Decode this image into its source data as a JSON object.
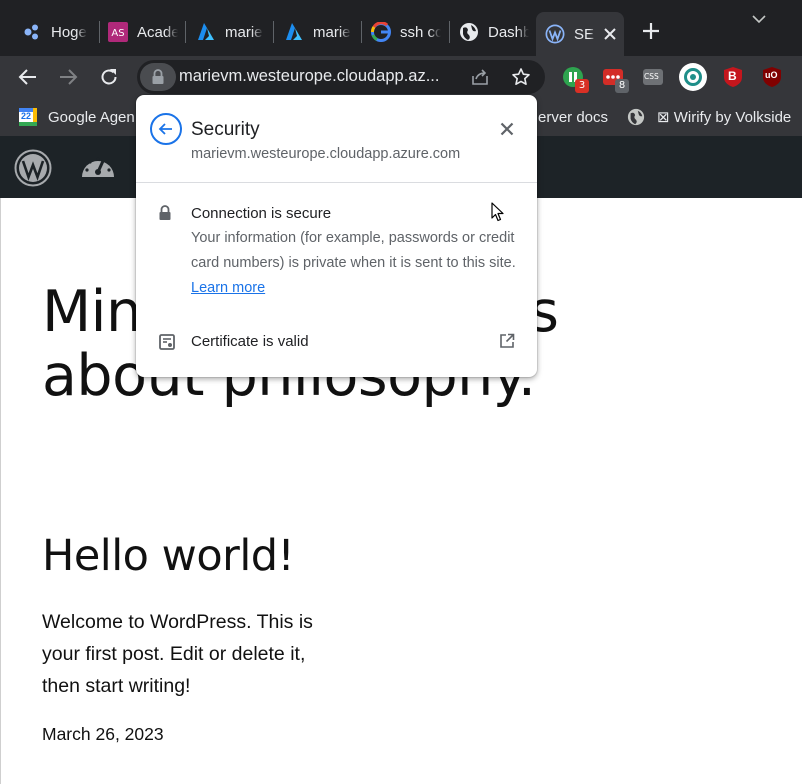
{
  "browser": {
    "tabs": [
      {
        "title": "Hoge",
        "icon": "bees-icon"
      },
      {
        "title": "Acade",
        "icon": "as-icon"
      },
      {
        "title": "marie",
        "icon": "azure-icon"
      },
      {
        "title": "marie",
        "icon": "azure-icon"
      },
      {
        "title": "ssh cc",
        "icon": "google-icon"
      },
      {
        "title": "Dashb",
        "icon": "globe-icon"
      },
      {
        "title": "SE",
        "icon": "wordpress-icon",
        "active": true
      }
    ],
    "url": "marievm.westeurope.cloudapp.az...",
    "extensions": {
      "badge_one": "3",
      "badge_two": "8",
      "css_label": "CSS",
      "ab_label": "B",
      "ub_label": "uO"
    }
  },
  "bookmarks": {
    "items": [
      {
        "label": "Google Agen",
        "icon_text": "22"
      },
      {
        "label": "erver docs"
      },
      {
        "label": "⊠ Wirify by Volkside"
      }
    ]
  },
  "popup": {
    "title": "Security",
    "subtitle": "marievm.westeurope.cloudapp.azure.com",
    "connection": {
      "title": "Connection is secure",
      "description": "Your information (for example, passwords or credit card numbers) is private when it is sent to this site.",
      "learn_more": "Learn more"
    },
    "certificate": {
      "title": "Certificate is valid"
    }
  },
  "page": {
    "site_title": "Mindful reflections about philosophy.",
    "post_title": "Hello world!",
    "post_excerpt": "Welcome to WordPress. This is your first post. Edit or delete it, then start writing!",
    "post_date": "March 26, 2023"
  },
  "colors": {
    "accent": "#1a73e8",
    "tabstrip": "#202124",
    "toolbar": "#35363a",
    "wp_admin_bar": "#1d2327"
  }
}
